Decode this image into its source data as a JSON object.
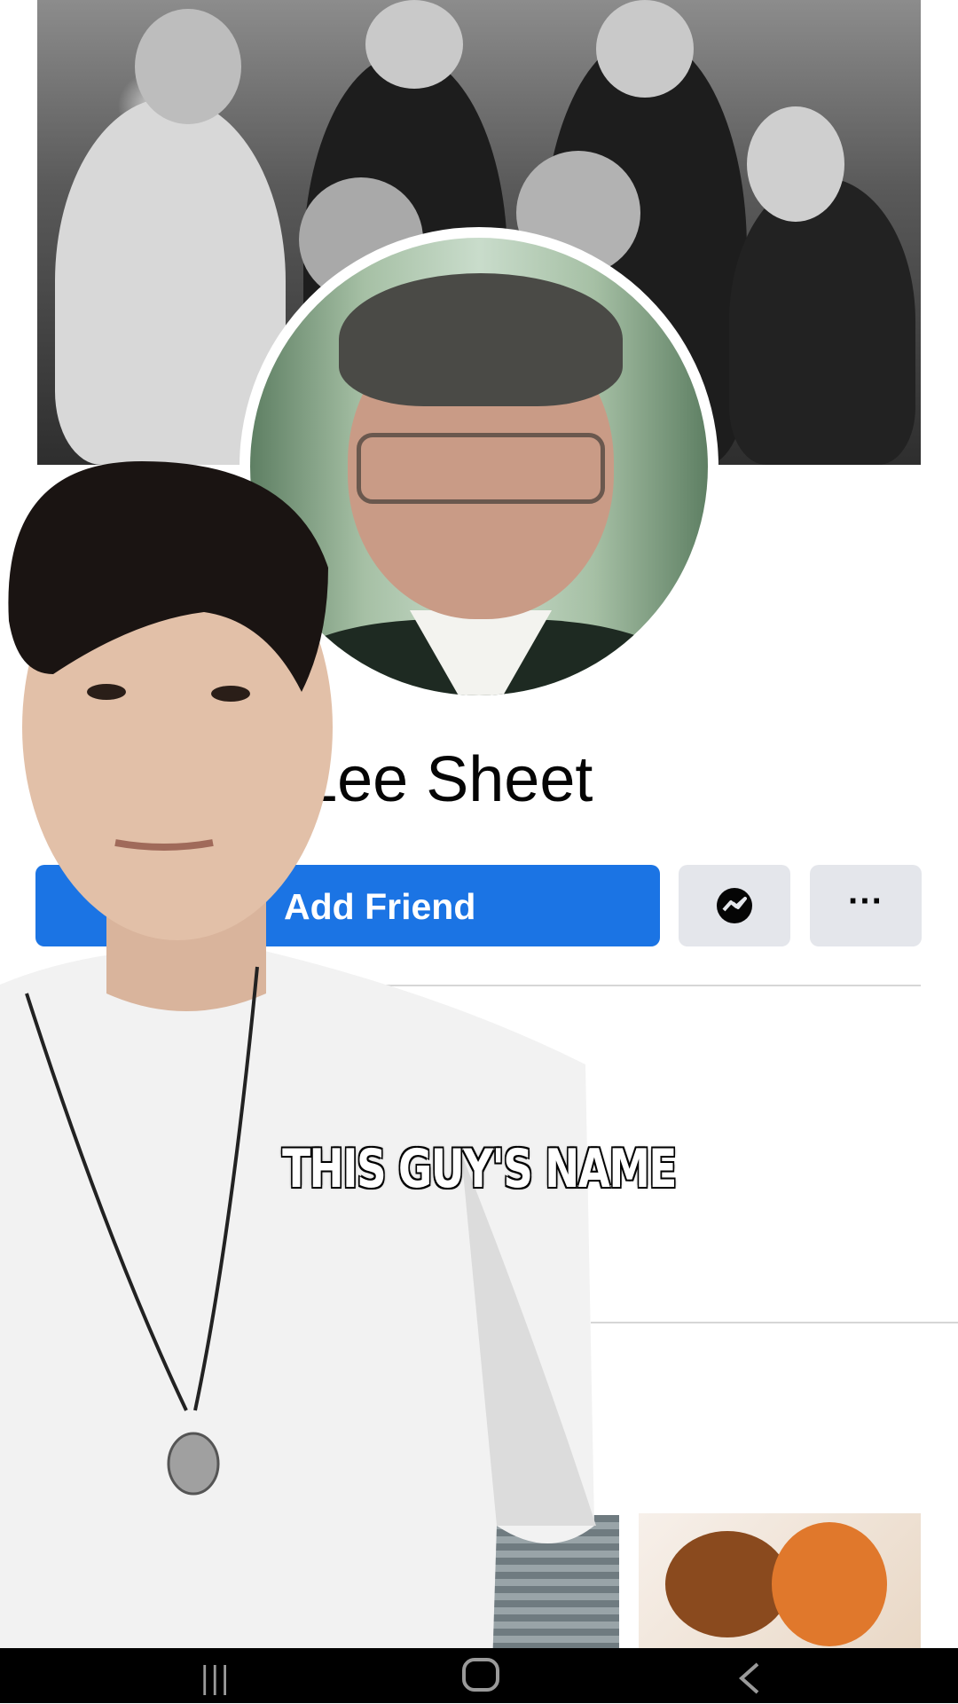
{
  "profile": {
    "name_visible": "oo Lee Sheet"
  },
  "actions": {
    "add_friend_label": "Add Friend",
    "messenger_icon": "messenger-icon",
    "more_label": "···"
  },
  "caption": {
    "text": "THIS GUY'S NAME"
  },
  "colors": {
    "accent": "#1b74e4",
    "secondary_button": "#e4e6eb",
    "background": "#ffffff"
  },
  "navigation": {
    "recents_icon": "recents-icon",
    "home_icon": "home-icon",
    "back_icon": "back-icon"
  }
}
